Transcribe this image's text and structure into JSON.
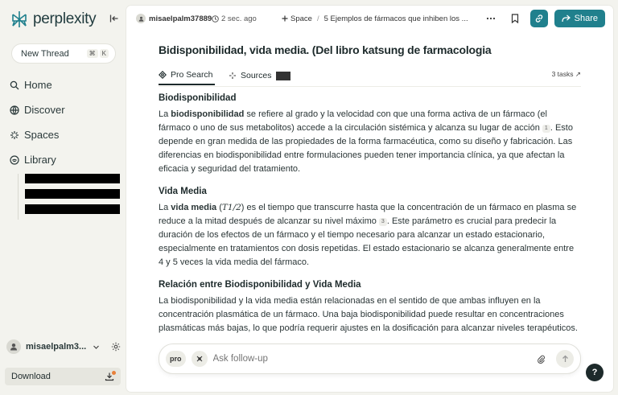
{
  "sidebar": {
    "logo_text": "perplexity",
    "new_thread": {
      "label": "New Thread",
      "keys": [
        "⌘",
        "K"
      ]
    },
    "nav": [
      {
        "label": "Home",
        "icon": "search-icon"
      },
      {
        "label": "Discover",
        "icon": "globe-icon"
      },
      {
        "label": "Spaces",
        "icon": "spaces-icon"
      },
      {
        "label": "Library",
        "icon": "library-icon"
      }
    ],
    "user": {
      "name": "misaelpalm3..."
    },
    "download_label": "Download"
  },
  "topbar": {
    "user": "misaelpalm37889",
    "time": "2 sec. ago",
    "space_label": "Space",
    "thread_crumb": "5 Ejemplos de fármacos que inhiben los ...",
    "share_label": "Share"
  },
  "thread": {
    "title": "Bidisponibilidad, vida media. (Del libro katsung de farmacologia",
    "tabs": {
      "pro_search": "Pro Search",
      "sources": "Sources"
    },
    "tasks": "3 tasks ↗"
  },
  "answer": {
    "s1": {
      "heading": "Biodisponibilidad",
      "t1": "La ",
      "b1": "biodisponibilidad",
      "t2": " se refiere al grado y la velocidad con que una forma activa de un fármaco (el fármaco o uno de sus metabolitos) accede a la circulación sistémica y alcanza su lugar de acción ",
      "c1": "1",
      "t3": ". Esto depende en gran medida de las propiedades de la forma farmacéutica, como su diseño y fabricación. Las diferencias en biodisponibilidad entre formulaciones pueden tener importancia clínica, ya que afectan la eficacia y seguridad del tratamiento."
    },
    "s2": {
      "heading": "Vida Media",
      "t1": "La ",
      "b1": "vida media",
      "t2": " (",
      "math": "T1/2",
      "t3": ") es el tiempo que transcurre hasta que la concentración de un fármaco en plasma se reduce a la mitad después de alcanzar su nivel máximo ",
      "c1": "3",
      "t4": ". Este parámetro es crucial para predecir la duración de los efectos de un fármaco y el tiempo necesario para alcanzar un estado estacionario, especialmente en tratamientos con dosis repetidas. El estado estacionario se alcanza generalmente entre 4 y 5 veces la vida media del fármaco."
    },
    "s3": {
      "heading": "Relación entre Biodisponibilidad y Vida Media",
      "text": "La biodisponibilidad y la vida media están relacionadas en el sentido de que ambas influyen en la concentración plasmática de un fármaco. Una baja biodisponibilidad puede resultar en concentraciones plasmáticas más bajas, lo que podría requerir ajustes en la dosificación para alcanzar niveles terapéuticos."
    }
  },
  "followup": {
    "pro_label": "pro",
    "placeholder": "Ask follow-up"
  },
  "help_label": "?",
  "colors": {
    "accent": "#20808d",
    "background": "#f3f3ee"
  }
}
